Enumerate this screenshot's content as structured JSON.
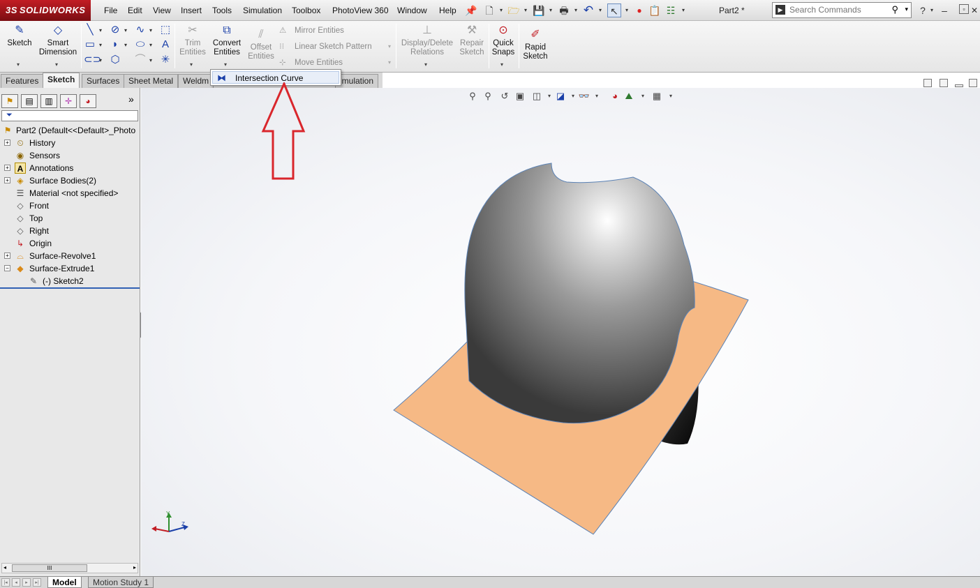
{
  "app": {
    "logo_text": "SOLIDWORKS",
    "logo_prefix": "3S",
    "document_title": "Part2 *"
  },
  "menu": [
    "File",
    "Edit",
    "View",
    "Insert",
    "Tools",
    "Simulation",
    "Toolbox",
    "PhotoView 360",
    "Window",
    "Help"
  ],
  "search": {
    "placeholder": "Search Commands"
  },
  "ribbon": {
    "sketch": "Sketch",
    "smart_dimension_1": "Smart",
    "smart_dimension_2": "Dimension",
    "trim_1": "Trim",
    "trim_2": "Entities",
    "convert_1": "Convert",
    "convert_2": "Entities",
    "offset_1": "Offset",
    "offset_2": "Entities",
    "mirror": "Mirror Entities",
    "linear_pattern": "Linear Sketch Pattern",
    "move": "Move Entities",
    "display_delete_1": "Display/Delete",
    "display_delete_2": "Relations",
    "repair_1": "Repair",
    "repair_2": "Sketch",
    "quick_snaps_1": "Quick",
    "quick_snaps_2": "Snaps",
    "rapid_sketch_1": "Rapid",
    "rapid_sketch_2": "Sketch"
  },
  "tabs": [
    "Features",
    "Sketch",
    "Surfaces",
    "Sheet Metal",
    "Weldm",
    "imulation"
  ],
  "active_tab": "Sketch",
  "popup": {
    "item": "Intersection Curve"
  },
  "feature_tree": {
    "root": "Part2  (Default<<Default>_Photo",
    "items": [
      {
        "label": "History"
      },
      {
        "label": "Sensors"
      },
      {
        "label": "Annotations"
      },
      {
        "label": "Surface Bodies(2)"
      },
      {
        "label": "Material <not specified>"
      },
      {
        "label": "Front"
      },
      {
        "label": "Top"
      },
      {
        "label": "Right"
      },
      {
        "label": "Origin"
      },
      {
        "label": "Surface-Revolve1"
      },
      {
        "label": "Surface-Extrude1"
      },
      {
        "label": "(-) Sketch2"
      }
    ]
  },
  "scroll_thumb": "III",
  "bottom_tabs": [
    "Model",
    "Motion Study 1"
  ],
  "triad": {
    "y": "Y",
    "z": "Z"
  },
  "colors": {
    "surface_orange": "#f6b985",
    "dome_gray": "#8a8a8a",
    "annotation_red": "#d9262c",
    "logo_red": "#c21d24"
  }
}
